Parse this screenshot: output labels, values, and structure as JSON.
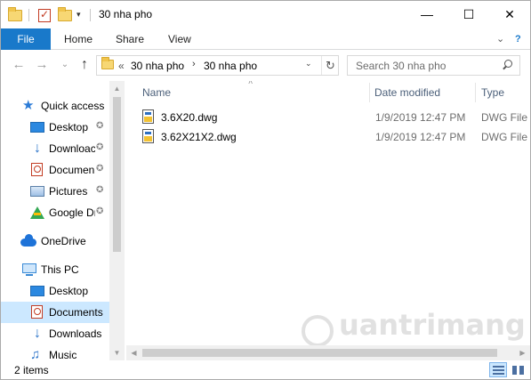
{
  "titlebar": {
    "title": "30 nha pho",
    "minimize": "—",
    "maximize": "☐",
    "close": "✕"
  },
  "ribbon": {
    "tabs": [
      "File",
      "Home",
      "Share",
      "View"
    ],
    "expand": "⌄",
    "help": "?"
  },
  "nav": {
    "back": "←",
    "forward": "→",
    "recent": "⌄",
    "up": "↑",
    "address": {
      "prefix": "«",
      "segments": [
        "30 nha pho",
        "30 nha pho"
      ],
      "separator": "›",
      "dropdown": "⌄",
      "refresh": "↻"
    },
    "search_placeholder": "Search 30 nha pho"
  },
  "navpane": {
    "items": [
      {
        "label": "Quick access",
        "icon": "star-icon",
        "pinned": false
      },
      {
        "label": "Desktop",
        "icon": "desktop-icon",
        "pinned": true
      },
      {
        "label": "Downloac",
        "icon": "download-icon",
        "pinned": true
      },
      {
        "label": "Documen",
        "icon": "documents-icon",
        "pinned": true
      },
      {
        "label": "Pictures",
        "icon": "pictures-icon",
        "pinned": true
      },
      {
        "label": "Google Dr",
        "icon": "google-drive-icon",
        "pinned": true
      },
      {
        "label": "OneDrive",
        "icon": "onedrive-icon",
        "pinned": false
      },
      {
        "label": "This PC",
        "icon": "this-pc-icon",
        "pinned": false
      },
      {
        "label": "Desktop",
        "icon": "desktop-icon",
        "pinned": false
      },
      {
        "label": "Documents",
        "icon": "documents-icon",
        "pinned": false,
        "selected": true
      },
      {
        "label": "Downloads",
        "icon": "download-icon",
        "pinned": false
      },
      {
        "label": "Music",
        "icon": "music-icon",
        "pinned": false
      }
    ],
    "pin_glyph": "📌"
  },
  "content": {
    "columns": [
      "Name",
      "Date modified",
      "Type"
    ],
    "sort_glyph": "˄",
    "files": [
      {
        "name": "3.6X20.dwg",
        "date": "1/9/2019 12:47 PM",
        "type": "DWG File"
      },
      {
        "name": "3.62X21X2.dwg",
        "date": "1/9/2019 12:47 PM",
        "type": "DWG File"
      }
    ],
    "watermark": "uantrimang"
  },
  "status": {
    "count": "2 items"
  },
  "colors": {
    "accent": "#1979ca",
    "selected_bg": "#cce8ff",
    "header_text": "#4c607a"
  }
}
